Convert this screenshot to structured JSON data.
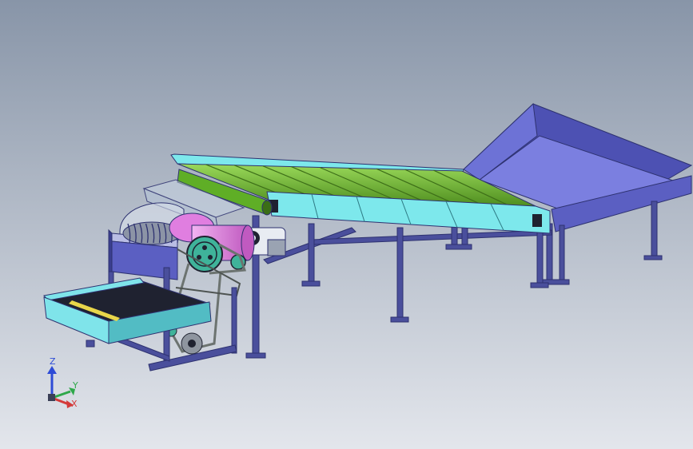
{
  "viewport": {
    "background_top": "#8895a8",
    "background_bottom": "#e3e6ec"
  },
  "colors": {
    "frame": "#4a4f9c",
    "frame_dark": "#2e3270",
    "conveyor_side": "#7de8ec",
    "conveyor_side_dark": "#52bcc4",
    "rollers": "#7cc23a",
    "rollers_dark": "#4f8e1f",
    "hopper": "#5b5fc2",
    "hopper_light": "#6d72d6",
    "tray": "#7fe4ea",
    "drum": "#e07ee0",
    "pulley": "#3fb39a",
    "belt": "#6c7370",
    "accent_yellow": "#e8d64a"
  },
  "triad": {
    "z_label": "Z",
    "y_label": "Y",
    "x_label": "X",
    "z_color": "#2d4bd6",
    "y_color": "#2ea84a",
    "x_color": "#d43a3a"
  }
}
